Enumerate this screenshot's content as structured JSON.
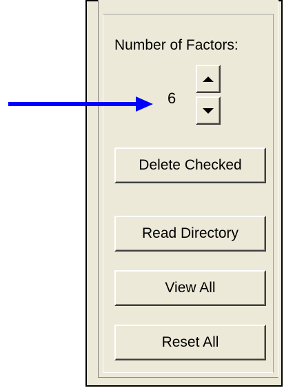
{
  "factors": {
    "label": "Number of Factors:",
    "value": "6",
    "increment_icon": "triangle-up",
    "decrement_icon": "triangle-down"
  },
  "buttons": {
    "delete_checked": "Delete Checked",
    "read_directory": "Read Directory",
    "view_all": "View All",
    "reset_all": "Reset All"
  },
  "annotation": {
    "arrow_color": "#0000ff",
    "icon": "arrow-right-icon"
  },
  "colors": {
    "panel_background": "#ece9d8",
    "frame_border": "#000000"
  }
}
